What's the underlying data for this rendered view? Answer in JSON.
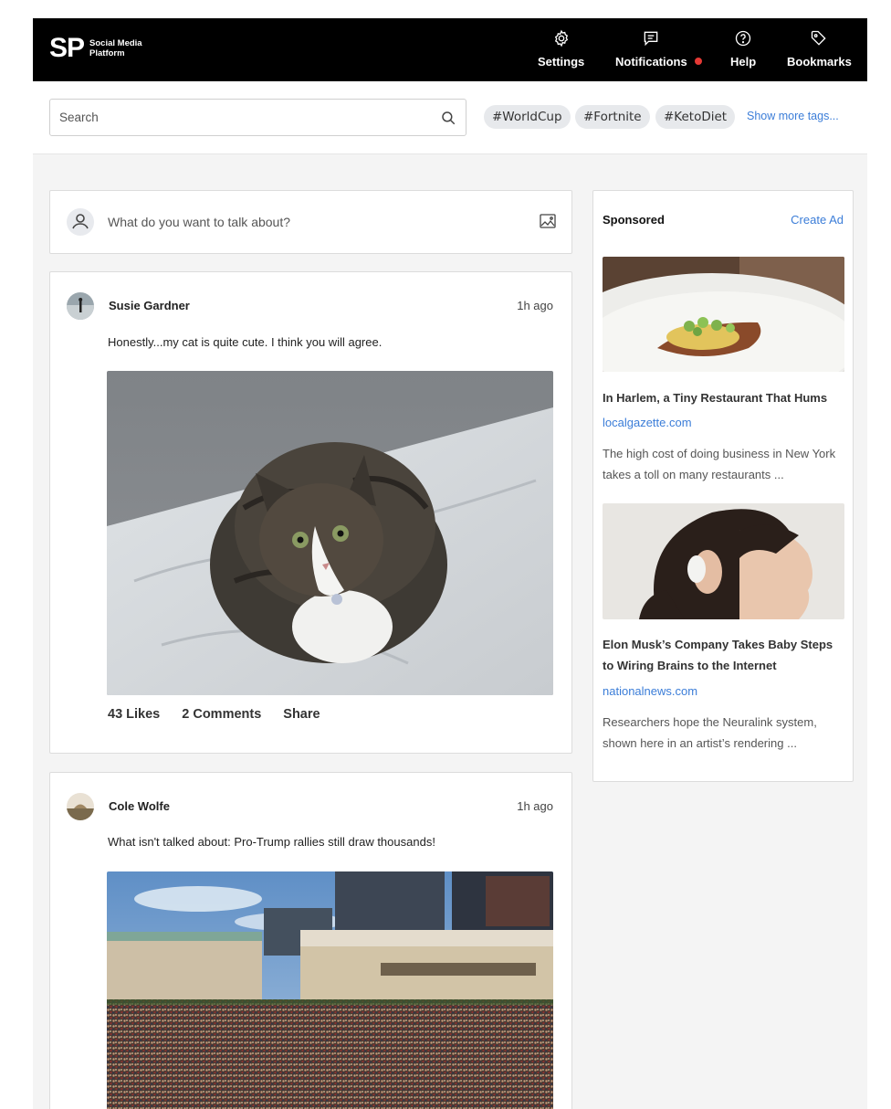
{
  "brand": {
    "mark": "SP",
    "name": "Social Media Platform"
  },
  "nav": [
    {
      "label": "Settings",
      "icon": "gear-icon"
    },
    {
      "label": "Notifications",
      "icon": "message-icon",
      "badge": true
    },
    {
      "label": "Help",
      "icon": "help-icon"
    },
    {
      "label": "Bookmarks",
      "icon": "tag-icon"
    }
  ],
  "search": {
    "placeholder": "Search"
  },
  "tags": [
    "#WorldCup",
    "#Fortnite",
    "#KetoDiet"
  ],
  "more_tags": "Show more tags...",
  "composer": {
    "placeholder": "What do you want to talk about?"
  },
  "posts": [
    {
      "author": "Susie Gardner",
      "time": "1h ago",
      "text": "Honestly...my cat is quite cute. I think you will agree.",
      "likes": "43 Likes",
      "comments": "2 Comments",
      "share": "Share"
    },
    {
      "author": "Cole Wolfe",
      "time": "1h ago",
      "text": "What isn't talked about: Pro-Trump rallies still draw thousands!"
    }
  ],
  "sponsored": {
    "title": "Sponsored",
    "create": "Create Ad",
    "ads": [
      {
        "headline": "In Harlem, a Tiny Restaurant That Hums",
        "domain": "localgazette.com",
        "description": "The high cost of doing business in New York takes a toll on many restaurants ..."
      },
      {
        "headline": "Elon Musk’s Company Takes Baby Steps to Wiring Brains to the Internet",
        "domain": "nationalnews.com",
        "description": "Researchers hope the Neuralink system, shown here in an artist’s rendering ..."
      }
    ]
  },
  "colors": {
    "accent": "#3b7dd8",
    "nav_bg": "#000000",
    "badge": "#e53935",
    "page_bg": "#f4f4f4"
  }
}
